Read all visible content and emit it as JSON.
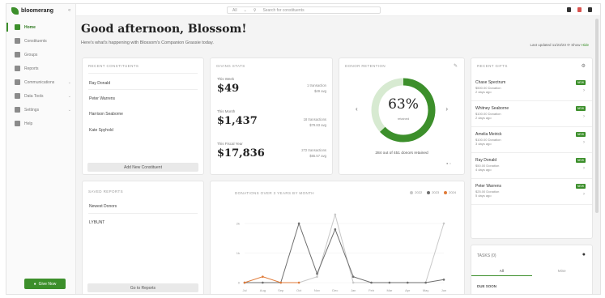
{
  "app": {
    "brand": "bloomerang",
    "greeting": "Good afternoon, Blossom!",
    "subtitle": "Here's what's happening with Blossom's Companion Grassie today.",
    "meta": "Last updated 11/23/23 ⟳ Show",
    "meta_link": "Hide"
  },
  "sidebar": {
    "items": [
      {
        "label": "Home",
        "active": true
      },
      {
        "label": "Constituents",
        "chev": false
      },
      {
        "label": "Groups",
        "chev": false
      },
      {
        "label": "Reports",
        "chev": false
      },
      {
        "label": "Communications",
        "chev": true
      },
      {
        "label": "Data Tools",
        "chev": true
      },
      {
        "label": "Settings",
        "chev": true
      },
      {
        "label": "Help",
        "chev": false
      }
    ],
    "upgrade_label": "Give Now"
  },
  "topbar": {
    "search_scope": "All",
    "search_placeholder": "Search for constituents"
  },
  "recent_constituents": {
    "title": "RECENT CONSTITUENTS",
    "items": [
      "Ray Donald",
      "Peter Warrens",
      "Harrison Seaborne",
      "Kate Spyhold"
    ],
    "button": "Add New Constituent"
  },
  "giving_stats": {
    "title": "GIVING STATS",
    "blocks": [
      {
        "label": "This Week",
        "value": "$49",
        "note1": "1 transaction",
        "note2": "$49 avg"
      },
      {
        "label": "This Month",
        "value": "$1,437",
        "note1": "18 transactions",
        "note2": "$79.83 avg"
      },
      {
        "label": "This Fiscal Year",
        "value": "$17,836",
        "note1": "272 transactions",
        "note2": "$65.57 avg"
      }
    ]
  },
  "donor_retention": {
    "title": "DONOR RETENTION",
    "percent": "63%",
    "fraction": 0.63,
    "sub": "retained",
    "caption": "284 out of 451 donors retained",
    "colors": {
      "arc": "#3c8f2b",
      "track": "#d7ead1"
    }
  },
  "recent_gifts": {
    "title": "RECENT GIFTS",
    "items": [
      {
        "name": "Chase Spectrum",
        "amount": "$500.00 Donation",
        "date": "2 days ago",
        "badge": "NEW"
      },
      {
        "name": "Whitney Seaborne",
        "amount": "$100.00 Donation",
        "date": "2 days ago",
        "badge": "NEW"
      },
      {
        "name": "Amelia Meirick",
        "amount": "$100.00 Donation",
        "date": "3 days ago",
        "badge": "NEW"
      },
      {
        "name": "Ray Donald",
        "amount": "$50.00 Donation",
        "date": "4 days ago",
        "badge": "NEW"
      },
      {
        "name": "Peter Warrens",
        "amount": "$25.00 Donation",
        "date": "5 days ago",
        "badge": "NEW"
      }
    ]
  },
  "saved_reports": {
    "title": "SAVED REPORTS",
    "items": [
      "Newest Donors",
      "LYBUNT"
    ],
    "button": "Go to Reports"
  },
  "tasks": {
    "title": "TASKS",
    "count": "(0)",
    "tabs": [
      "All",
      "Mine"
    ],
    "section": "DUE SOON"
  },
  "chart_data": {
    "type": "line",
    "title": "DONATIONS OVER 3 YEARS BY MONTH",
    "categories": [
      "Jul",
      "Aug",
      "Sep",
      "Oct",
      "Nov",
      "Dec",
      "Jan",
      "Feb",
      "Mar",
      "Apr",
      "May",
      "Jun"
    ],
    "series": [
      {
        "name": "2022",
        "color": "#c8c8c8",
        "values": [
          0,
          0,
          0,
          0,
          200,
          2300,
          0,
          0,
          0,
          0,
          0,
          2000
        ]
      },
      {
        "name": "2023",
        "color": "#6e6e6e",
        "values": [
          0,
          0,
          0,
          2000,
          300,
          1800,
          200,
          0,
          0,
          0,
          0,
          100
        ]
      },
      {
        "name": "2024",
        "color": "#e07b39",
        "values": [
          0,
          200,
          0,
          0,
          null,
          null,
          null,
          null,
          null,
          null,
          null,
          null
        ]
      }
    ],
    "yticks": [
      "0",
      "1k",
      "2k"
    ],
    "ylim": [
      0,
      2600
    ]
  }
}
